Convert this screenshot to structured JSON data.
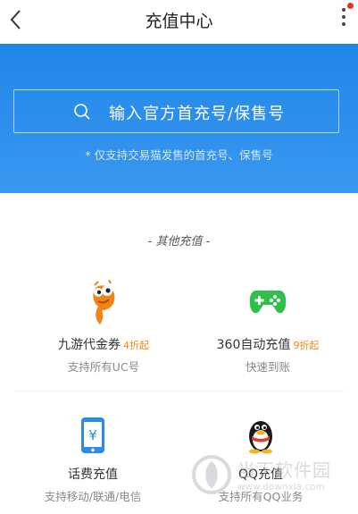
{
  "header": {
    "title": "充值中心"
  },
  "banner": {
    "search_placeholder": "输入官方首充号/保售号",
    "note": "* 仅支持交易猫发售的首充号、保售号"
  },
  "section": {
    "title": "- 其他充值 -"
  },
  "items": [
    {
      "name": "九游代金券",
      "badge": "4折起",
      "sub": "支持所有UC号",
      "icon": "nine-game-mascot-icon"
    },
    {
      "name": "360自动充值",
      "badge": "9折起",
      "sub": "快速到账",
      "icon": "gamepad-icon"
    },
    {
      "name": "话费充值",
      "badge": "",
      "sub": "支持移动/联通/电信",
      "icon": "phone-yuan-icon"
    },
    {
      "name": "QQ充值",
      "badge": "",
      "sub": "支持所有QQ业务",
      "icon": "qq-penguin-icon"
    }
  ],
  "watermark": {
    "name": "当下软件园",
    "url": "www.downxia.com"
  },
  "colors": {
    "banner": "#1f86e8",
    "badge": "#f08a18",
    "gamepad": "#2fbf4a",
    "phone": "#2a8cea"
  }
}
